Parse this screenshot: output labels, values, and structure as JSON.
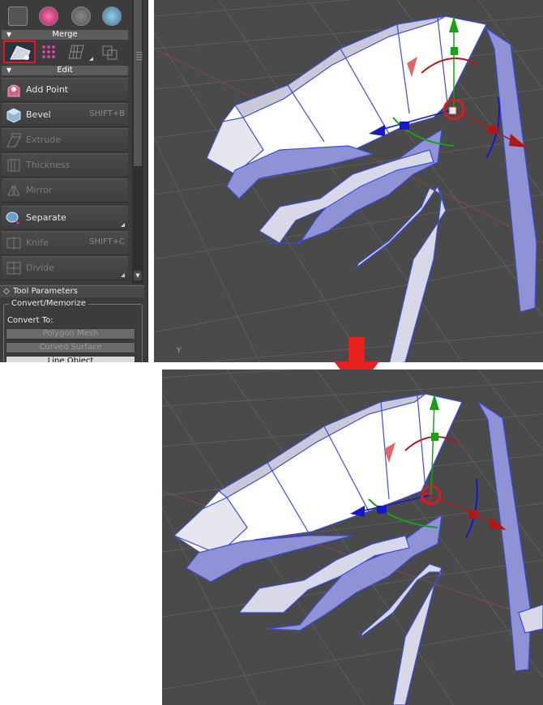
{
  "panel": {
    "sections": {
      "merge": "Merge",
      "edit": "Edit"
    },
    "tools": [
      {
        "label": "Add Point",
        "shortcut": "",
        "enabled": true,
        "icon": "add-point-icon"
      },
      {
        "label": "Bevel",
        "shortcut": "SHIFT+B",
        "enabled": true,
        "icon": "bevel-icon"
      },
      {
        "label": "Extrude",
        "shortcut": "",
        "enabled": false,
        "icon": "extrude-icon"
      },
      {
        "label": "Thickness",
        "shortcut": "",
        "enabled": false,
        "icon": "thickness-icon"
      },
      {
        "label": "Mirror",
        "shortcut": "",
        "enabled": false,
        "icon": "mirror-icon"
      },
      {
        "label": "Separate",
        "shortcut": "",
        "enabled": true,
        "icon": "separate-icon"
      },
      {
        "label": "Knife",
        "shortcut": "SHIFT+C",
        "enabled": false,
        "icon": "knife-icon"
      },
      {
        "label": "Divide",
        "shortcut": "",
        "enabled": false,
        "icon": "divide-icon"
      }
    ]
  },
  "tool_parameters": {
    "title": "Tool Parameters",
    "group_title": "Convert/Memorize",
    "convert_label": "Convert To:",
    "buttons": [
      "Polygon Mesh",
      "Curved Surface",
      "Line Object"
    ]
  },
  "viewport": {
    "axis_label": "Y"
  },
  "colors": {
    "highlight": "#e01b1b",
    "arrow": "#e82020",
    "mesh_edge": "#3a4ed8",
    "gizmo_x": "#b01818",
    "gizmo_y": "#18a018",
    "gizmo_z": "#1818c8"
  }
}
